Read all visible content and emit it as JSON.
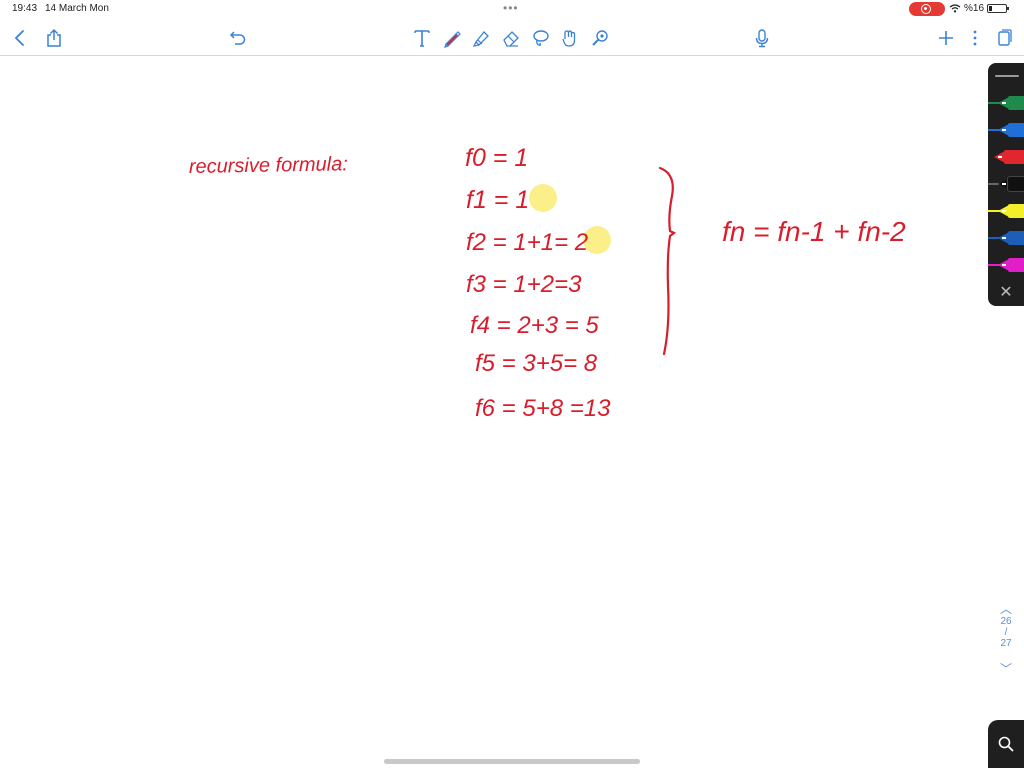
{
  "status": {
    "time": "19:43",
    "date": "14 March Mon",
    "battery": "%16"
  },
  "toolbar": {
    "icons": [
      "back-chevron-icon",
      "share-icon",
      "undo-icon",
      "text-tool-icon",
      "pen-tool-icon",
      "highlighter-tool-icon",
      "eraser-tool-icon",
      "lasso-tool-icon",
      "shapes-tool-icon",
      "laser-pointer-icon",
      "microphone-icon",
      "add-icon",
      "more-options-icon",
      "page-view-icon"
    ]
  },
  "notes": {
    "label": "recursive formula:",
    "lines": [
      "f0 = 1",
      "f1 = 1",
      "f2 = 1+1= 2",
      "f3 = 1+2=3",
      "f4 = 2+3 = 5",
      "f5 = 3+5= 8",
      "f6 = 5+8 =13"
    ],
    "formula": "fn = fn-1 + fn-2",
    "ink_color": "#d81e2c",
    "highlight_color": "#fbef8a"
  },
  "palette": {
    "pens": [
      {
        "name": "green",
        "color": "#1f8a4c"
      },
      {
        "name": "blue",
        "color": "#1f6fd6"
      },
      {
        "name": "red",
        "color": "#e0262e"
      },
      {
        "name": "black",
        "color": "#111111"
      },
      {
        "name": "yellow",
        "color": "#f3f02a"
      },
      {
        "name": "dark-blue",
        "color": "#1d5fb8"
      },
      {
        "name": "magenta",
        "color": "#e01fc8"
      }
    ]
  },
  "pagenav": {
    "current": "26",
    "separator": "/",
    "total": "27"
  }
}
